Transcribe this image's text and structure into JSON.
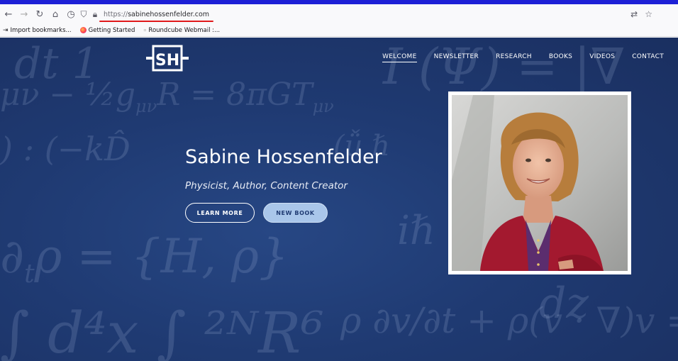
{
  "browser": {
    "url_scheme": "https://",
    "url_host": "sabinehossenfelder.com",
    "nav_icons": [
      "back-icon",
      "forward-icon",
      "reload-icon",
      "home-icon",
      "history-icon"
    ],
    "bookmarks": [
      {
        "label": "Import bookmarks...",
        "icon": "import-icon"
      },
      {
        "label": "Getting Started",
        "icon": "firefox-icon"
      },
      {
        "label": "Roundcube Webmail :...",
        "icon": "roundcube-icon"
      }
    ]
  },
  "site": {
    "logo_text": "SH",
    "nav": [
      {
        "label": "WELCOME",
        "active": true
      },
      {
        "label": "NEWSLETTER",
        "active": false
      },
      {
        "label": "RESEARCH",
        "active": false
      },
      {
        "label": "BOOKS",
        "active": false
      },
      {
        "label": "VIDEOS",
        "active": false
      },
      {
        "label": "CONTACT",
        "active": false
      }
    ],
    "hero": {
      "title": "Sabine Hossenfelder",
      "subtitle": "Physicist, Author, Content Creator",
      "learn_more": "LEARN MORE",
      "new_book": "NEW BOOK"
    }
  },
  "colors": {
    "hero_bg": "#1f3a72",
    "accent_button": "#a9c6ea",
    "url_underline": "#e0191b",
    "top_strip": "#1d20d6"
  }
}
